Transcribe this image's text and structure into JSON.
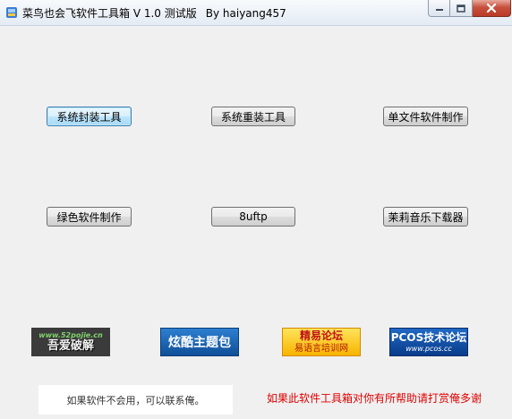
{
  "window": {
    "title": "菜鸟也会飞软件工具箱 V 1.0 测试版",
    "author": "By haiyang457"
  },
  "buttons": {
    "row1": [
      "系统封装工具",
      "系统重装工具",
      "单文件软件制作"
    ],
    "row2": [
      "绿色软件制作",
      "8uftp",
      "茉莉音乐下载器"
    ]
  },
  "banners": {
    "b1": {
      "url": "www.52pojie.cn",
      "text": "吾爱破解"
    },
    "b2": {
      "text": "炫酷主题包"
    },
    "b3": {
      "line1": "精易论坛",
      "line2": "易语言培训网"
    },
    "b4": {
      "line1": "PCOS技术论坛",
      "line2": "www.pcos.cc"
    }
  },
  "footer": {
    "contact": "如果软件不会用，可以联系俺。",
    "thanks": "如果此软件工具箱对你有所帮助请打赏俺多谢"
  },
  "icons": [
    "app-icon",
    "minimize-icon",
    "maximize-icon",
    "close-icon"
  ],
  "colors": {
    "thanks_text": "#e00000",
    "close_button": "#c7513e",
    "focus_border": "#3c7fb1"
  }
}
